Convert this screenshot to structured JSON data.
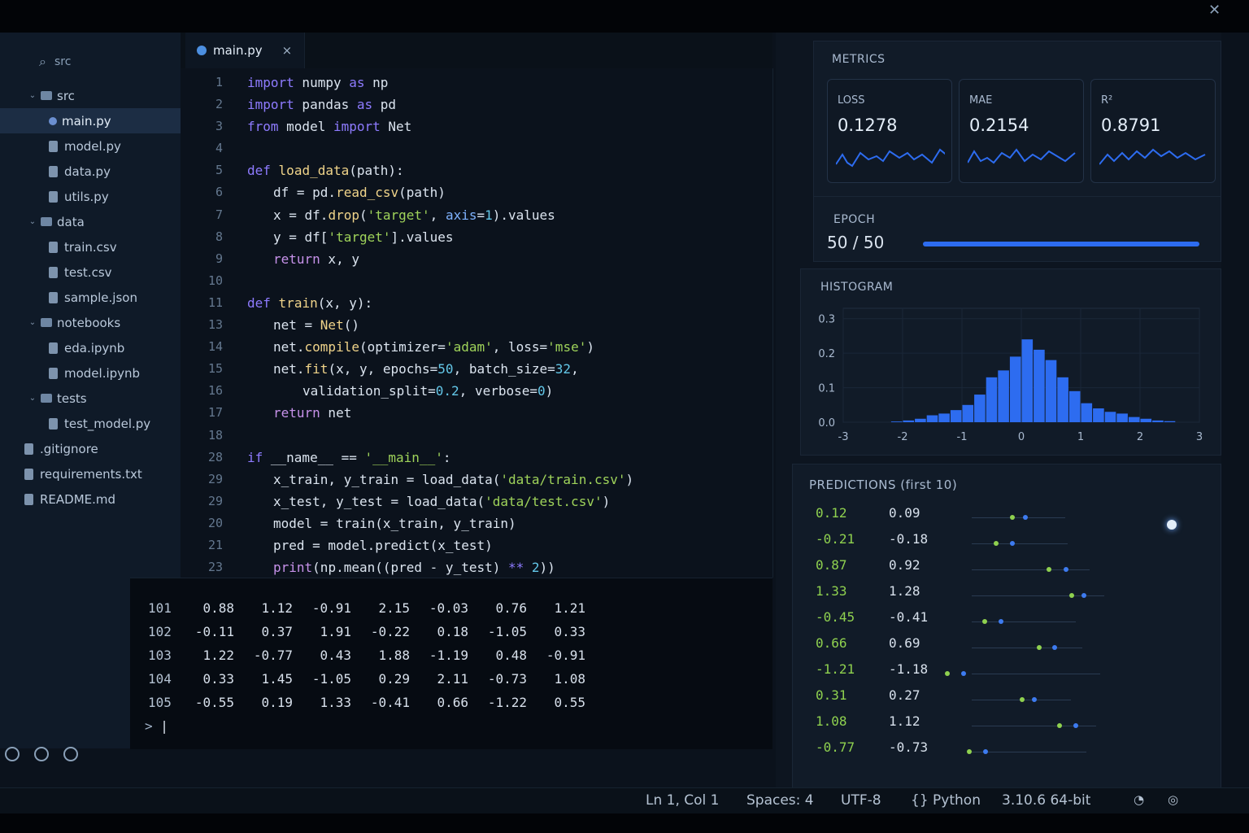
{
  "sidebar": {
    "header": "src",
    "items": [
      {
        "label": "src",
        "kind": "folder",
        "depth": 0
      },
      {
        "label": "main.py",
        "kind": "py",
        "depth": 1,
        "active": true
      },
      {
        "label": "model.py",
        "kind": "file",
        "depth": 1
      },
      {
        "label": "data.py",
        "kind": "file",
        "depth": 1
      },
      {
        "label": "utils.py",
        "kind": "file",
        "depth": 1
      },
      {
        "label": "data",
        "kind": "folder",
        "depth": 0
      },
      {
        "label": "train.csv",
        "kind": "file",
        "depth": 1
      },
      {
        "label": "test.csv",
        "kind": "file",
        "depth": 1
      },
      {
        "label": "sample.json",
        "kind": "file",
        "depth": 1
      },
      {
        "label": "notebooks",
        "kind": "folder",
        "depth": 0
      },
      {
        "label": "eda.ipynb",
        "kind": "file",
        "depth": 1
      },
      {
        "label": "model.ipynb",
        "kind": "file",
        "depth": 1
      },
      {
        "label": "tests",
        "kind": "folder",
        "depth": 0
      },
      {
        "label": "test_model.py",
        "kind": "file",
        "depth": 1
      },
      {
        "label": ".gitignore",
        "kind": "file",
        "depth": 0
      },
      {
        "label": "requirements.txt",
        "kind": "file",
        "depth": 0
      },
      {
        "label": "README.md",
        "kind": "file",
        "depth": 0
      }
    ]
  },
  "editor": {
    "tab_label": "main.py",
    "tab_close": "×",
    "line_numbers": [
      "1",
      "2",
      "3",
      "4",
      "5",
      "6",
      "7",
      "8",
      "9",
      "10",
      "11",
      "13",
      "14",
      "15",
      "16",
      "17",
      "18",
      "28",
      "29",
      "29",
      "20",
      "21",
      "23"
    ],
    "lines": [
      {
        "indent": 0,
        "tokens": [
          [
            "kw",
            "import"
          ],
          [
            "t",
            " numpy "
          ],
          [
            "kw",
            "as"
          ],
          [
            "t",
            " np"
          ]
        ]
      },
      {
        "indent": 0,
        "tokens": [
          [
            "kw",
            "import"
          ],
          [
            "t",
            " pandas "
          ],
          [
            "kw",
            "as"
          ],
          [
            "t",
            " pd"
          ]
        ]
      },
      {
        "indent": 0,
        "tokens": [
          [
            "kw",
            "from"
          ],
          [
            "t",
            " model "
          ],
          [
            "kw",
            "import"
          ],
          [
            "t",
            " Net"
          ]
        ]
      },
      {
        "indent": 0,
        "tokens": []
      },
      {
        "indent": 0,
        "tokens": [
          [
            "kw",
            "def"
          ],
          [
            "t",
            " "
          ],
          [
            "fn",
            "load_data"
          ],
          [
            "t",
            "(path):"
          ]
        ]
      },
      {
        "indent": 1,
        "tokens": [
          [
            "t",
            "df = pd."
          ],
          [
            "fn",
            "read_csv"
          ],
          [
            "t",
            "(path)"
          ]
        ]
      },
      {
        "indent": 1,
        "tokens": [
          [
            "t",
            "x = df."
          ],
          [
            "fn",
            "drop"
          ],
          [
            "t",
            "("
          ],
          [
            "str",
            "'target'"
          ],
          [
            "t",
            ", "
          ],
          [
            "prm",
            "axis"
          ],
          [
            "t",
            "="
          ],
          [
            "num",
            "1"
          ],
          [
            "t",
            ").values"
          ]
        ]
      },
      {
        "indent": 1,
        "tokens": [
          [
            "t",
            "y = df["
          ],
          [
            "str",
            "'target'"
          ],
          [
            "t",
            "].values"
          ]
        ]
      },
      {
        "indent": 1,
        "tokens": [
          [
            "kw2",
            "return"
          ],
          [
            "t",
            " x, y"
          ]
        ]
      },
      {
        "indent": 0,
        "tokens": []
      },
      {
        "indent": 0,
        "tokens": [
          [
            "kw",
            "def"
          ],
          [
            "t",
            " "
          ],
          [
            "fn",
            "train"
          ],
          [
            "t",
            "(x, y):"
          ]
        ]
      },
      {
        "indent": 1,
        "tokens": [
          [
            "t",
            "net = "
          ],
          [
            "cls",
            "Net"
          ],
          [
            "t",
            "()"
          ]
        ]
      },
      {
        "indent": 1,
        "tokens": [
          [
            "t",
            "net."
          ],
          [
            "fn",
            "compile"
          ],
          [
            "t",
            "(optimizer="
          ],
          [
            "str",
            "'adam'"
          ],
          [
            "t",
            ", loss="
          ],
          [
            "str",
            "'mse'"
          ],
          [
            "t",
            ")"
          ]
        ]
      },
      {
        "indent": 1,
        "tokens": [
          [
            "t",
            "net."
          ],
          [
            "fn",
            "fit"
          ],
          [
            "t",
            "(x, y, epochs="
          ],
          [
            "num",
            "50"
          ],
          [
            "t",
            ", batch_size="
          ],
          [
            "num",
            "32"
          ],
          [
            "t",
            ","
          ]
        ]
      },
      {
        "indent": 2,
        "tokens": [
          [
            "t",
            "validation_split="
          ],
          [
            "num",
            "0.2"
          ],
          [
            "t",
            ", verbose="
          ],
          [
            "num",
            "0"
          ],
          [
            "t",
            ")"
          ]
        ]
      },
      {
        "indent": 1,
        "tokens": [
          [
            "kw2",
            "return"
          ],
          [
            "t",
            " net"
          ]
        ]
      },
      {
        "indent": 0,
        "tokens": []
      },
      {
        "indent": 0,
        "tokens": [
          [
            "kw",
            "if"
          ],
          [
            "t",
            " __name__ == "
          ],
          [
            "str",
            "'__main__'"
          ],
          [
            "t",
            ":"
          ]
        ]
      },
      {
        "indent": 1,
        "tokens": [
          [
            "t",
            "x_train, y_train = load_data("
          ],
          [
            "str",
            "'data/train.csv'"
          ],
          [
            "t",
            ")"
          ]
        ]
      },
      {
        "indent": 1,
        "tokens": [
          [
            "t",
            "x_test, y_test = load_data("
          ],
          [
            "str",
            "'data/test.csv'"
          ],
          [
            "t",
            ")"
          ]
        ]
      },
      {
        "indent": 1,
        "tokens": [
          [
            "t",
            "model = train(x_train, y_train)"
          ]
        ]
      },
      {
        "indent": 1,
        "tokens": [
          [
            "t",
            "pred = model.predict(x_test)"
          ]
        ]
      },
      {
        "indent": 1,
        "tokens": [
          [
            "kw2",
            "print"
          ],
          [
            "t",
            "(np.mean((pred - y_test) "
          ],
          [
            "kw",
            "**"
          ],
          [
            "t",
            " "
          ],
          [
            "num",
            "2"
          ],
          [
            "t",
            "))"
          ]
        ]
      }
    ]
  },
  "terminal": {
    "rows": [
      [
        "101",
        "0.88",
        "1.12",
        "-0.91",
        "2.15",
        "-0.03",
        "0.76",
        "1.21"
      ],
      [
        "102",
        "-0.11",
        "0.37",
        "1.91",
        "-0.22",
        "0.18",
        "-1.05",
        "0.33"
      ],
      [
        "103",
        "1.22",
        "-0.77",
        "0.43",
        "1.88",
        "-1.19",
        "0.48",
        "-0.91"
      ],
      [
        "104",
        "0.33",
        "1.45",
        "-1.05",
        "0.29",
        "2.11",
        "-0.73",
        "1.08"
      ],
      [
        "105",
        "-0.55",
        "0.19",
        "1.33",
        "-0.41",
        "0.66",
        "-1.22",
        "0.55"
      ]
    ],
    "prompt": ">"
  },
  "metrics": {
    "title": "METRICS",
    "cards": [
      {
        "name": "LOSS",
        "value": "0.1278"
      },
      {
        "name": "MAE",
        "value": "0.2154"
      },
      {
        "name": "R²",
        "value": "0.8791"
      }
    ],
    "epoch_label": "EPOCH",
    "epoch_value": "50 / 50",
    "epoch_progress": 1.0
  },
  "histogram": {
    "title": "HISTOGRAM"
  },
  "predictions": {
    "title": "PREDICTIONS (first 10)",
    "rows": [
      [
        "0.12",
        "0.09"
      ],
      [
        "-0.21",
        "-0.18"
      ],
      [
        "0.87",
        "0.92"
      ],
      [
        "1.33",
        "1.28"
      ],
      [
        "-0.45",
        "-0.41"
      ],
      [
        "0.66",
        "0.69"
      ],
      [
        "-1.21",
        "-1.18"
      ],
      [
        "0.31",
        "0.27"
      ],
      [
        "1.08",
        "1.12"
      ],
      [
        "-0.77",
        "-0.73"
      ]
    ]
  },
  "statusbar": {
    "position": "Ln 1, Col 1",
    "spaces": "Spaces: 4",
    "encoding": "UTF-8",
    "language": "{} Python",
    "version": "3.10.6 64-bit"
  },
  "colors": {
    "keyword": "#8e7bff",
    "keyword2": "#c792ea",
    "function": "#f0d48a",
    "string": "#9fd35a",
    "number": "#63c7e8",
    "param": "#7fb3ff",
    "class": "#f0d48a",
    "accent": "#2d6cf0",
    "pred_green": "#8fd14f"
  },
  "chart_data": {
    "type": "bar",
    "title": "HISTOGRAM",
    "xlabel": "",
    "ylabel": "",
    "x_ticks": [
      "-3",
      "-2",
      "-1",
      "0",
      "1",
      "2",
      "3"
    ],
    "y_ticks": [
      "0.0",
      "0.1",
      "0.2",
      "0.3"
    ],
    "ylim": [
      0,
      0.33
    ],
    "xlim": [
      -3,
      3
    ],
    "bin_edges": [
      -3.0,
      -2.8,
      -2.6,
      -2.4,
      -2.2,
      -2.0,
      -1.8,
      -1.6,
      -1.4,
      -1.2,
      -1.0,
      -0.8,
      -0.6,
      -0.4,
      -0.2,
      0.0,
      0.2,
      0.4,
      0.6,
      0.8,
      1.0,
      1.2,
      1.4,
      1.6,
      1.8,
      2.0,
      2.2,
      2.4,
      2.6,
      2.8,
      3.0
    ],
    "values": [
      0.0,
      0.0,
      0.0,
      0.0,
      0.002,
      0.005,
      0.01,
      0.02,
      0.025,
      0.035,
      0.05,
      0.08,
      0.13,
      0.15,
      0.19,
      0.24,
      0.21,
      0.18,
      0.13,
      0.09,
      0.055,
      0.04,
      0.03,
      0.025,
      0.015,
      0.01,
      0.005,
      0.003,
      0.0,
      0.0
    ]
  }
}
